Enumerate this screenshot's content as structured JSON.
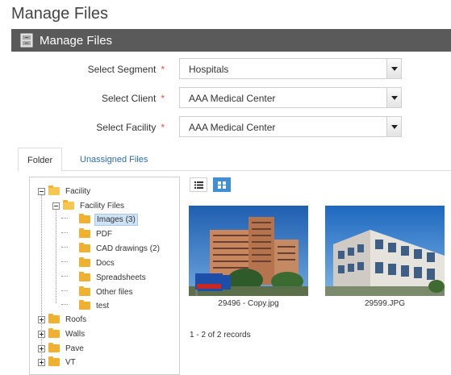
{
  "page": {
    "title": "Manage Files"
  },
  "panel": {
    "title": "Manage Files",
    "icon": "file-cabinet-icon"
  },
  "form": {
    "segment": {
      "label": "Select Segment",
      "required": "*",
      "value": "Hospitals"
    },
    "client": {
      "label": "Select Client",
      "required": "*",
      "value": "AAA Medical Center"
    },
    "facility": {
      "label": "Select Facility",
      "required": "*",
      "value": "AAA Medical Center"
    }
  },
  "tabs": [
    {
      "label": "Folder"
    },
    {
      "label": "Unassigned Files"
    }
  ],
  "tree": {
    "root": {
      "label": "Facility"
    },
    "facility_files": {
      "label": "Facility Files"
    },
    "children": [
      {
        "label": "Images (3)"
      },
      {
        "label": "PDF"
      },
      {
        "label": "CAD drawings (2)"
      },
      {
        "label": "Docs"
      },
      {
        "label": "Spreadsheets"
      },
      {
        "label": "Other files"
      },
      {
        "label": "test"
      }
    ],
    "top_level": [
      {
        "label": "Roofs"
      },
      {
        "label": "Walls"
      },
      {
        "label": "Pave"
      },
      {
        "label": "VT"
      }
    ]
  },
  "files": [
    {
      "name": "29496 - Copy.jpg"
    },
    {
      "name": "29599.JPG"
    }
  ],
  "records": {
    "text": "1 - 2 of 2 records"
  },
  "colors": {
    "header_bg": "#5a5a5a",
    "accent": "#3f8fd2",
    "link": "#2a6db5",
    "required": "#d9534f",
    "folder": "#f0b030"
  }
}
